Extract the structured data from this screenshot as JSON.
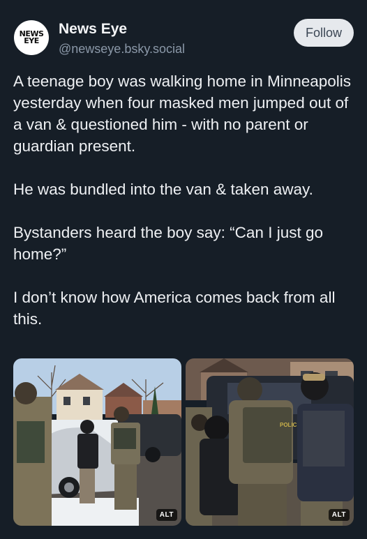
{
  "author": {
    "avatar_lines": [
      "NEWS",
      "EYE"
    ],
    "display_name": "News Eye",
    "handle": "@newseye.bsky.social"
  },
  "follow_label": "Follow",
  "post": {
    "paragraphs": [
      "A teenage boy was walking home in Minneapolis yesterday when four masked men jumped out of a van & questioned him - with no parent or guardian present.",
      "He was bundled into the van & taken away.",
      "Bystanders heard the boy say: “Can I just go home?”",
      "I don’t know how America comes back from all this."
    ]
  },
  "media": {
    "images": [
      {
        "alt_badge": "ALT"
      },
      {
        "alt_badge": "ALT",
        "vest_text": "POLICE"
      }
    ]
  },
  "colors": {
    "background": "#161e27",
    "follow_bg": "#e6e9ed",
    "handle": "#8b98a8"
  }
}
